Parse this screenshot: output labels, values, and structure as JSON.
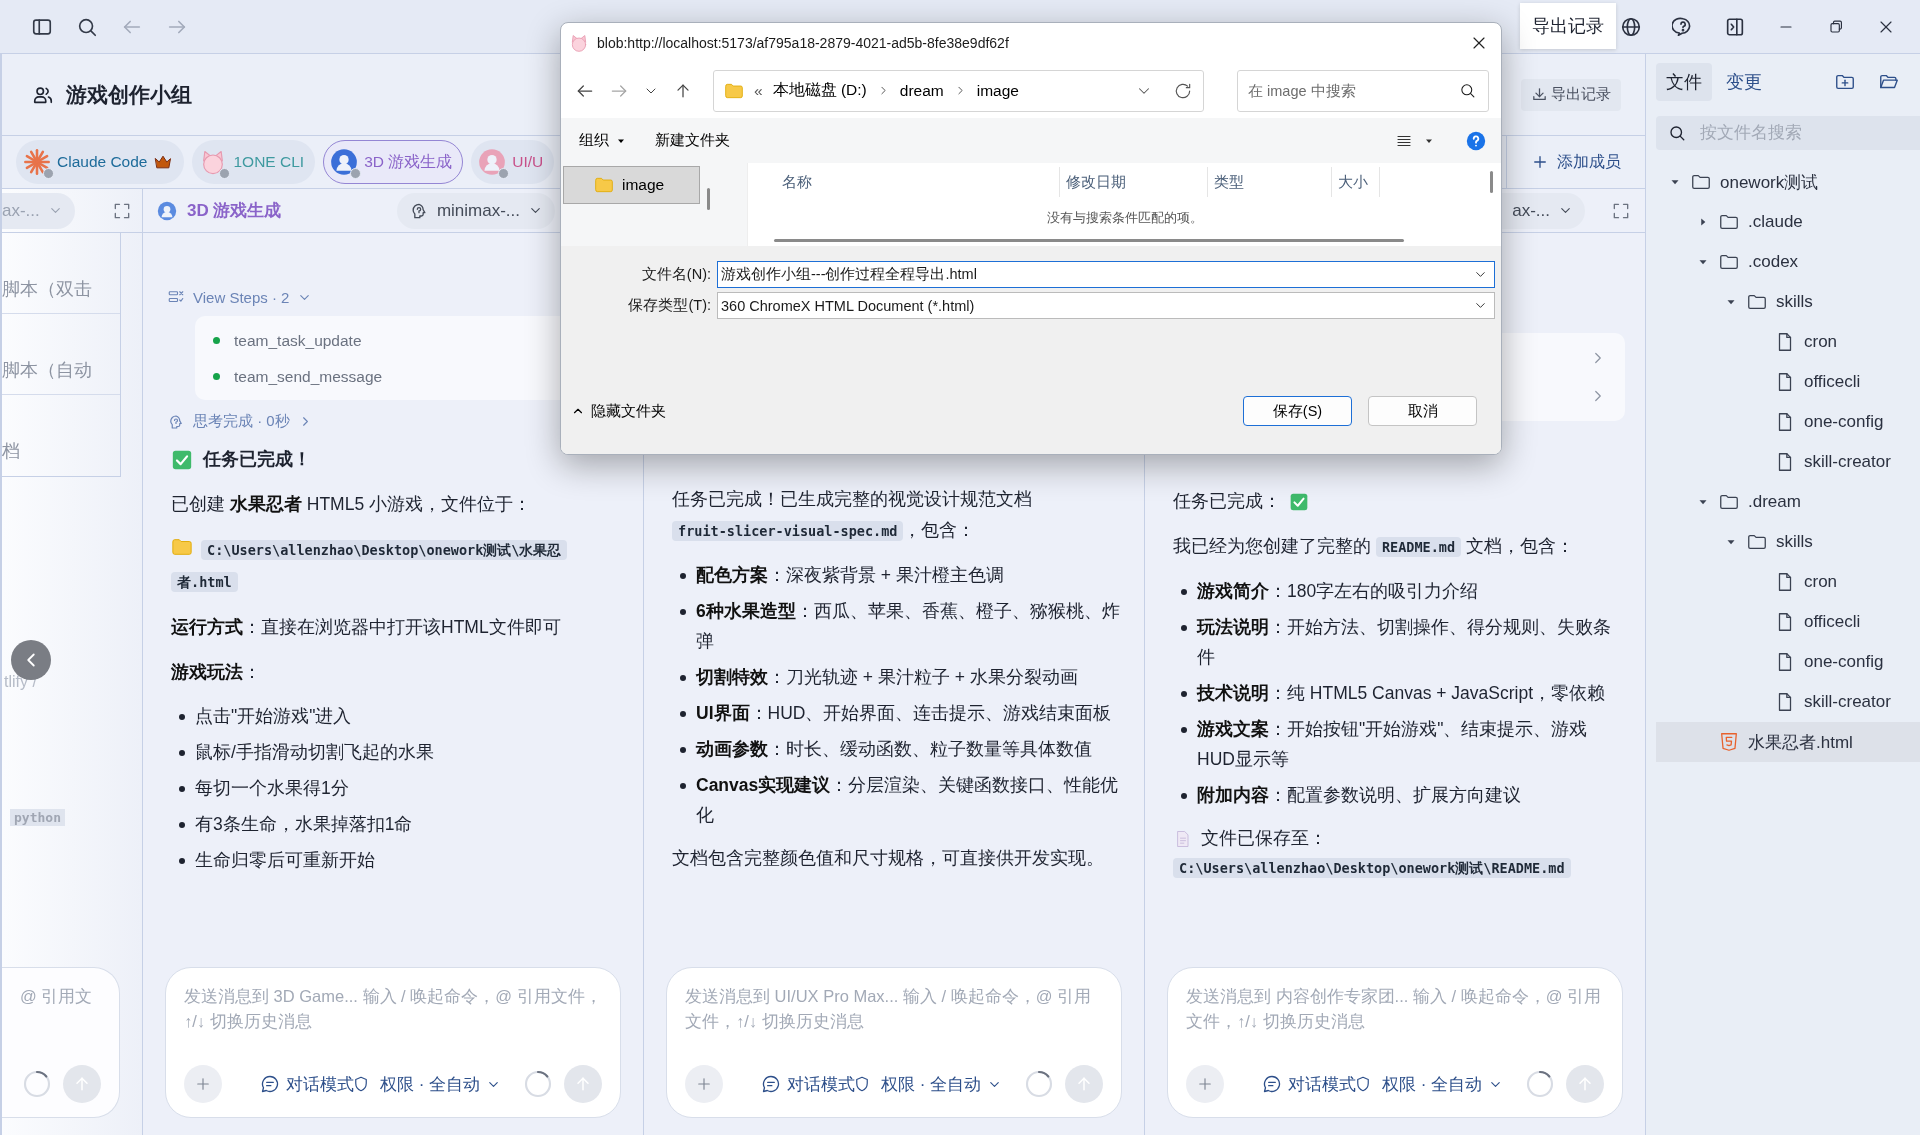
{
  "top_bar": {
    "tooltip": "导出记录"
  },
  "group": {
    "title": "游戏创作小组",
    "export_button": "导出记录"
  },
  "members": [
    {
      "name": "Claude Code",
      "kind": "spark",
      "color": "#1d6b9a",
      "leader": true,
      "selected": false
    },
    {
      "name": "1ONE CLI",
      "kind": "cat",
      "color": "#3f9aa0",
      "leader": false,
      "selected": false
    },
    {
      "name": "3D 游戏生成",
      "kind": "avatar",
      "color": "#8a63c9",
      "leader": false,
      "selected": true
    },
    {
      "name": "UI/U",
      "kind": "avatar",
      "color": "#c8508a",
      "leader": false,
      "selected": false
    }
  ],
  "add_member": "添加成员",
  "columns": [
    {
      "kind": "partial",
      "model": "ax-...",
      "expand_button": true,
      "items": [
        "脚本（双击",
        "脚本（自动",
        "档"
      ],
      "fragment": "tlify /",
      "code": "python",
      "input": {
        "placeholder": "@ 引用文"
      }
    },
    {
      "kind": "chat",
      "agent": "3D 游戏生成",
      "model": "minimax-...",
      "steps": {
        "label": "View Steps · 2",
        "items": [
          "team_task_update",
          "team_send_message"
        ]
      },
      "thinking": "思考完成 · 0秒",
      "blocks": [
        {
          "kind": "heading",
          "text": "任务已完成！"
        },
        {
          "kind": "para",
          "text": "已创建 **水果忍者** HTML5 小游戏，文件位于："
        },
        {
          "kind": "path",
          "text": "C:\\Users\\allenzhao\\Desktop\\onework测试\\水果忍者.html"
        },
        {
          "kind": "para",
          "text": "**运行方式**：直接在浏览器中打开该HTML文件即可"
        },
        {
          "kind": "para",
          "text": "**游戏玩法**："
        },
        {
          "kind": "list",
          "items": [
            "点击\"开始游戏\"进入",
            "鼠标/手指滑动切割飞起的水果",
            "每切一个水果得1分",
            "有3条生命，水果掉落扣1命",
            "生命归零后可重新开始"
          ]
        }
      ],
      "input": {
        "placeholder": "发送消息到 3D Game... 输入 / 唤起命令，@ 引用文件，↑/↓ 切换历史消息",
        "mode": "对话模式",
        "permission": "权限 · 全自动"
      }
    },
    {
      "kind": "chat",
      "blocks": [
        {
          "kind": "parts",
          "parts": [
            {
              "text": "任务已完成！已生成完整的视觉设计规范文档 "
            },
            {
              "code": "fruit-slicer-visual-spec.md"
            },
            {
              "text": "，包含："
            }
          ]
        },
        {
          "kind": "list",
          "items": [
            "**配色方案**：深夜紫背景 + 果汁橙主色调",
            "**6种水果造型**：西瓜、苹果、香蕉、橙子、猕猴桃、炸弹",
            "**切割特效**：刀光轨迹 + 果汁粒子 + 水果分裂动画",
            "**UI界面**：HUD、开始界面、连击提示、游戏结束面板",
            "**动画参数**：时长、缓动函数、粒子数量等具体数值",
            "**Canvas实现建议**：分层渲染、关键函数接口、性能优化"
          ]
        },
        {
          "kind": "para",
          "text": "文档包含完整颜色值和尺寸规格，可直接供开发实现。"
        }
      ],
      "input": {
        "placeholder": "发送消息到 UI/UX Pro Max... 输入 / 唤起命令，@ 引用文件，↑/↓ 切换历史消息",
        "mode": "对话模式",
        "permission": "权限 · 全自动"
      }
    },
    {
      "kind": "chat",
      "model": "ax-...",
      "expand_button": true,
      "step_rows": [
        {
          "expanded": false
        },
        {
          "expanded": false
        }
      ],
      "blocks": [
        {
          "kind": "status",
          "text": "任务已完成："
        },
        {
          "kind": "parts",
          "parts": [
            {
              "text": "我已经为您创建了完整的 "
            },
            {
              "code": "README.md"
            },
            {
              "text": " 文档，包含："
            }
          ]
        },
        {
          "kind": "list",
          "items": [
            "**游戏简介**：180字左右的吸引力介绍",
            "**玩法说明**：开始方法、切割操作、得分规则、失败条件",
            "**技术说明**：纯 HTML5 Canvas + JavaScript，零依赖",
            "**游戏文案**：开始按钮\"开始游戏\"、结束提示、游戏HUD显示等",
            "**附加内容**：配置参数说明、扩展方向建议"
          ]
        },
        {
          "kind": "note",
          "text": "文件已保存至："
        },
        {
          "kind": "code",
          "text": "C:\\Users\\allenzhao\\Desktop\\onework测试\\README.md"
        }
      ],
      "input": {
        "placeholder": "发送消息到 内容创作专家团... 输入 / 唤起命令，@ 引用文件，↑/↓ 切换历史消息",
        "mode": "对话模式",
        "permission": "权限 · 全自动"
      }
    }
  ],
  "dialog": {
    "title": "blob:http://localhost:5173/af795a18-2879-4021-ad5b-8fe38e9df62f",
    "crumb_prefix": "«",
    "breadcrumbs": [
      "本地磁盘 (D:)",
      "dream",
      "image"
    ],
    "search": {
      "placeholder": "在 image 中搜索"
    },
    "toolbar": [
      {
        "label": "组织",
        "kind": "menu"
      },
      {
        "label": "新建文件夹",
        "kind": "button"
      }
    ],
    "nav_items": [
      {
        "label": "image",
        "selected": true
      }
    ],
    "columns": [
      "名称",
      "修改日期",
      "类型",
      "大小"
    ],
    "empty_message": "没有与搜索条件匹配的项。",
    "fields": [
      {
        "label": "文件名(N):",
        "value": "游戏创作小组---创作过程全程导出.html",
        "focused": true
      },
      {
        "label": "保存类型(T):",
        "value": "360 ChromeX HTML Document (*.html)",
        "focused": false
      }
    ],
    "hide_folders": "隐藏文件夹",
    "buttons": [
      {
        "label": "保存(S)",
        "default": true
      },
      {
        "label": "取消",
        "default": false
      }
    ]
  },
  "files": {
    "tabs": [
      {
        "label": "文件",
        "selected": true
      },
      {
        "label": "变更",
        "selected": false
      }
    ],
    "search": {
      "placeholder": "按文件名搜索"
    },
    "tree": [
      {
        "name": "onework测试",
        "kind": "folder",
        "expanded": true,
        "selected": false,
        "children": [
          {
            "name": ".claude",
            "kind": "folder",
            "expanded": false,
            "selected": false
          },
          {
            "name": ".codex",
            "kind": "folder",
            "expanded": true,
            "selected": false,
            "children": [
              {
                "name": "skills",
                "kind": "folder",
                "expanded": true,
                "selected": false,
                "children": [
                  {
                    "name": "cron",
                    "kind": "file",
                    "selected": false
                  },
                  {
                    "name": "officecli",
                    "kind": "file",
                    "selected": false
                  },
                  {
                    "name": "one-config",
                    "kind": "file",
                    "selected": false
                  },
                  {
                    "name": "skill-creator",
                    "kind": "file",
                    "selected": false
                  }
                ]
              }
            ]
          },
          {
            "name": ".dream",
            "kind": "folder",
            "expanded": true,
            "selected": false,
            "children": [
              {
                "name": "skills",
                "kind": "folder",
                "expanded": true,
                "selected": false,
                "children": [
                  {
                    "name": "cron",
                    "kind": "file",
                    "selected": false
                  },
                  {
                    "name": "officecli",
                    "kind": "file",
                    "selected": false
                  },
                  {
                    "name": "one-config",
                    "kind": "file",
                    "selected": false
                  },
                  {
                    "name": "skill-creator",
                    "kind": "file",
                    "selected": false
                  }
                ]
              }
            ]
          },
          {
            "name": "水果忍者.html",
            "kind": "html",
            "selected": true
          }
        ]
      }
    ]
  }
}
